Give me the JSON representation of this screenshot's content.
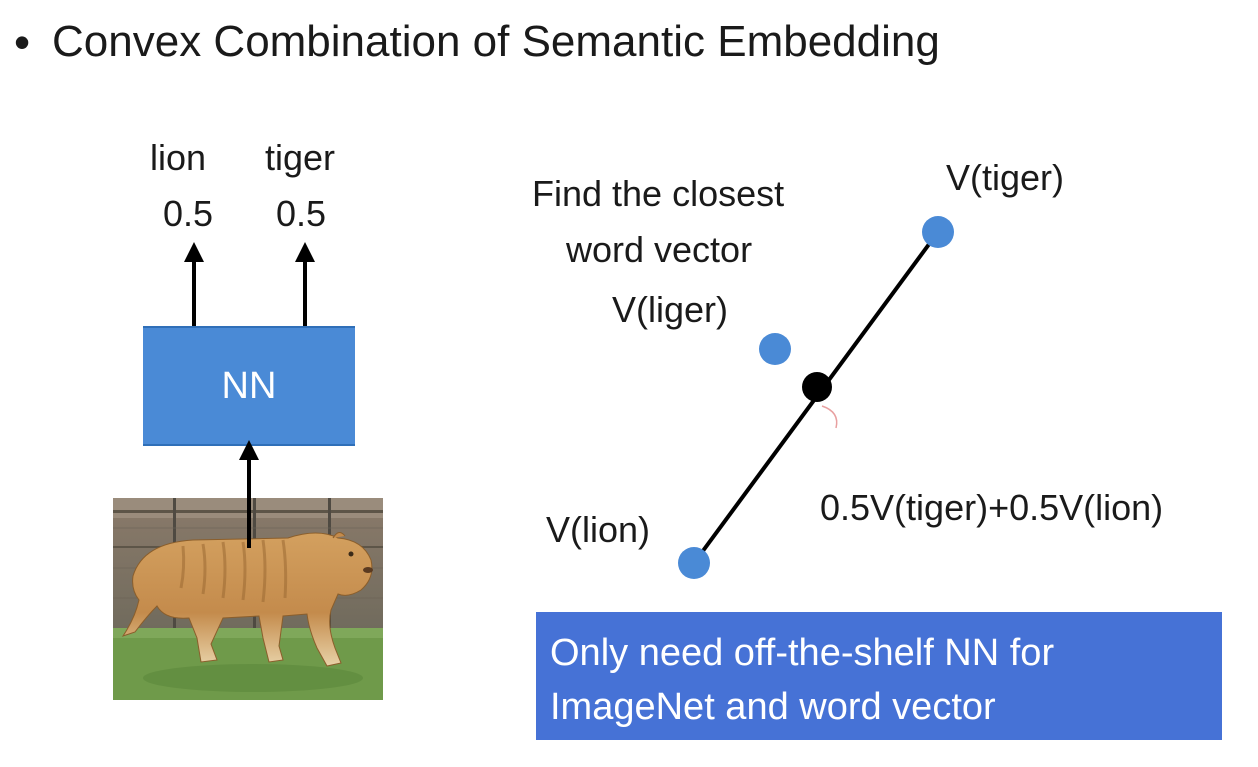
{
  "slide": {
    "bullet": "•",
    "title": "Convex Combination of Semantic Embedding"
  },
  "nn_diagram": {
    "outputs": [
      {
        "label": "lion",
        "value": "0.5"
      },
      {
        "label": "tiger",
        "value": "0.5"
      }
    ],
    "box_label": "NN",
    "input_image": "liger-photo"
  },
  "embedding_diagram": {
    "points": {
      "tiger": "V(tiger)",
      "lion": "V(lion)",
      "liger": "V(liger)"
    },
    "midpoint_label": "0.5V(tiger)+0.5V(lion)",
    "note_lines": [
      "Find the closest",
      "word vector"
    ],
    "point_color": "#4a8ad6",
    "midpoint_color": "#000000"
  },
  "callout": {
    "lines": [
      "Only need off-the-shelf NN for",
      "ImageNet and word vector"
    ],
    "background": "#4672d6"
  }
}
